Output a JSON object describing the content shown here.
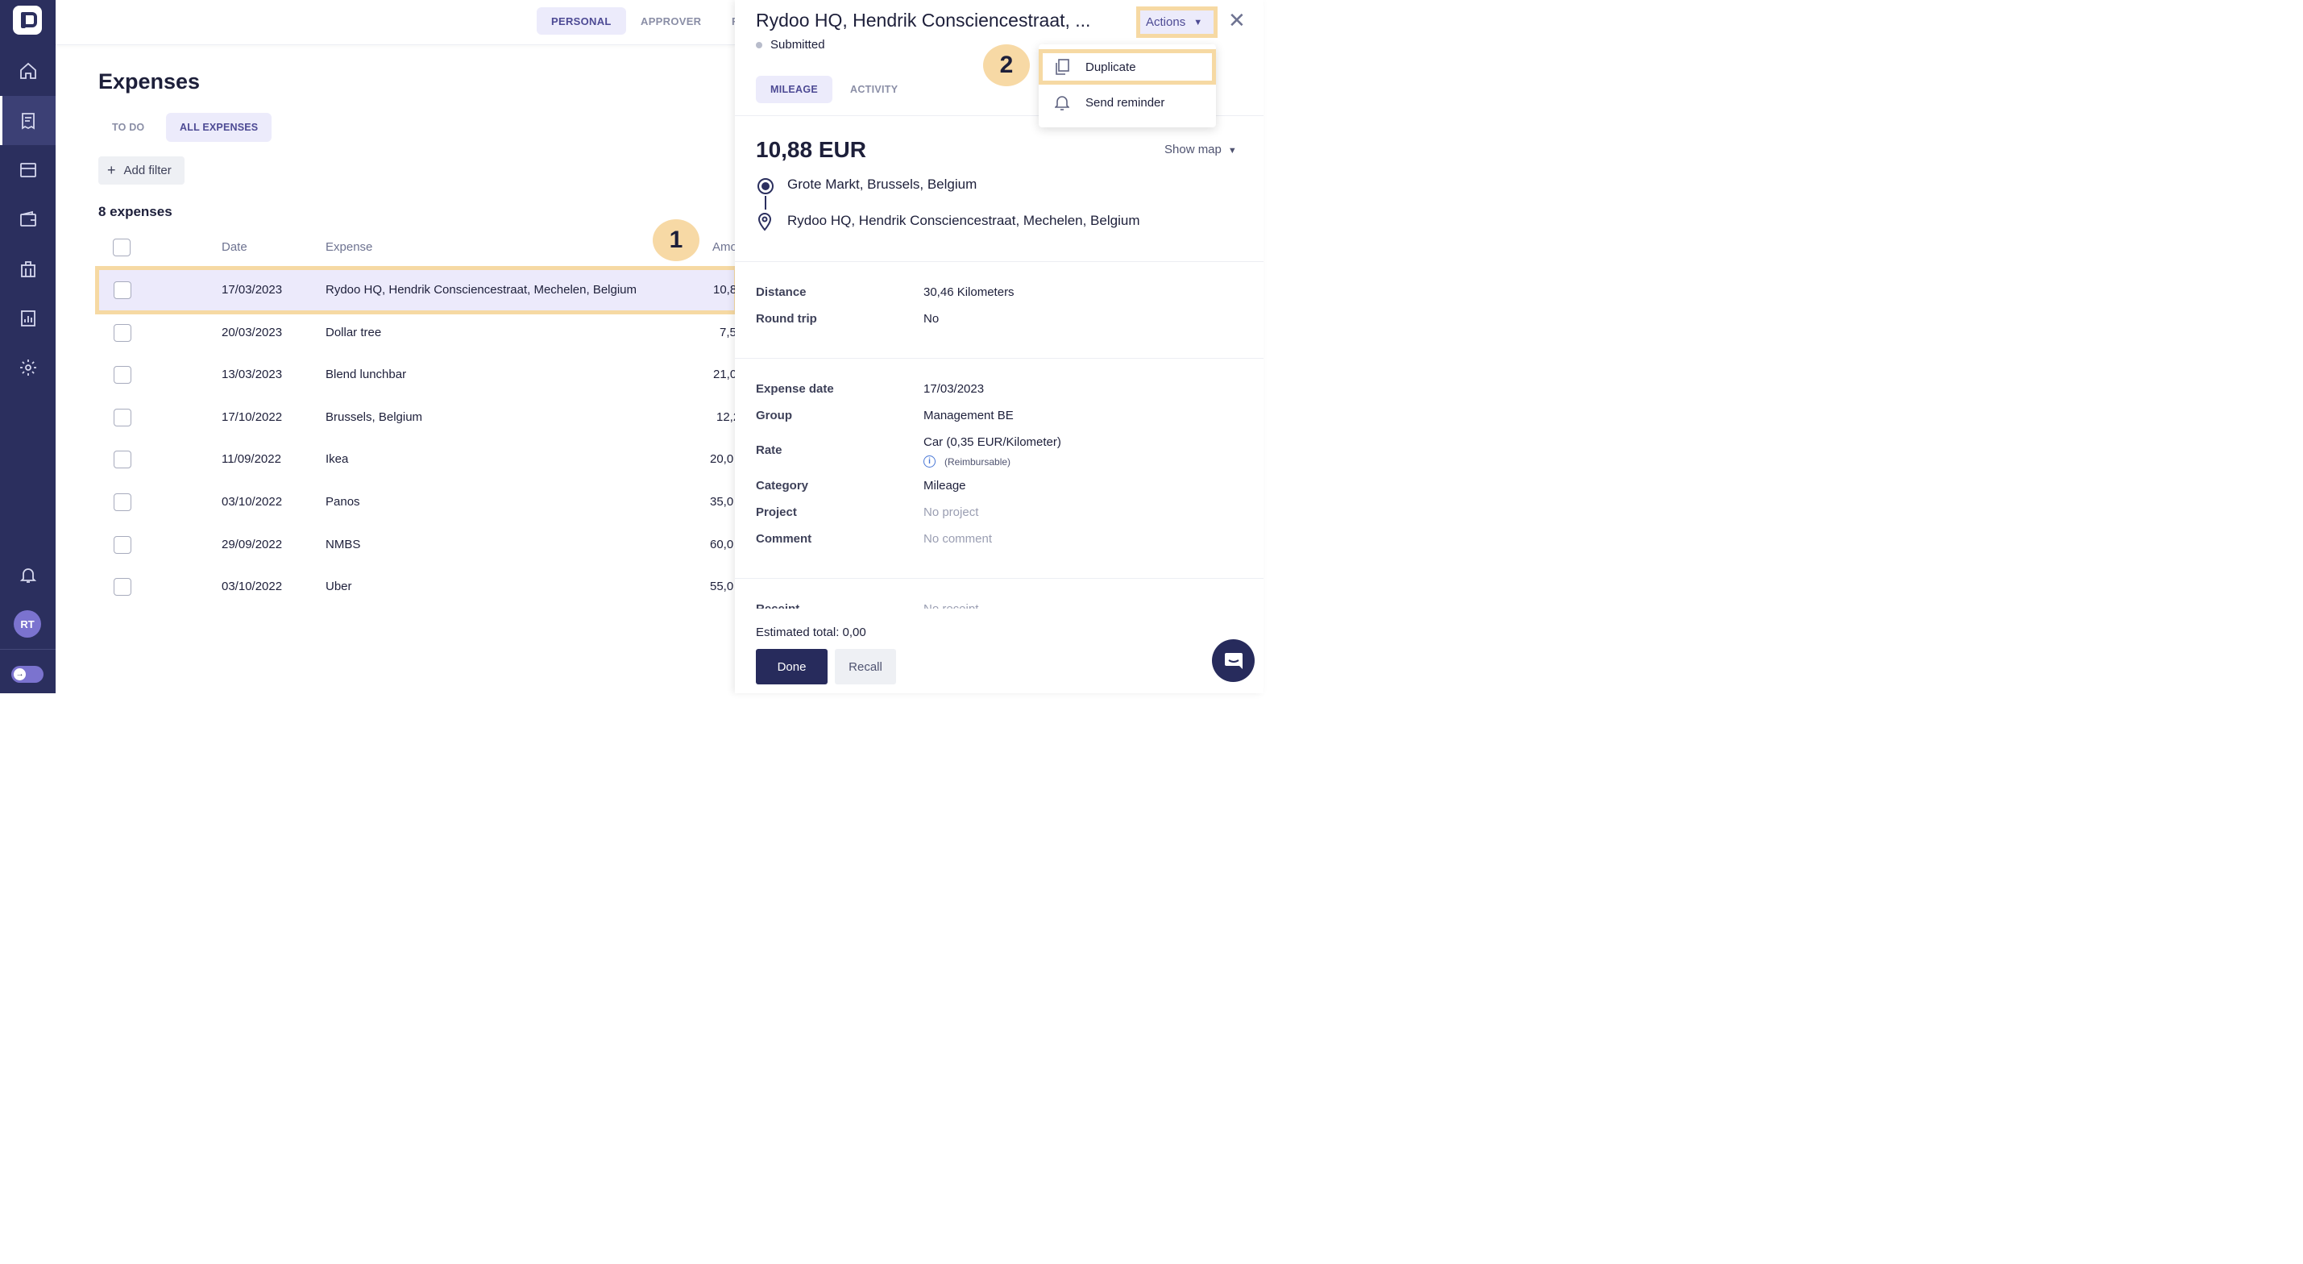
{
  "sidebar": {
    "nav_icons": [
      "home-icon",
      "expenses-icon",
      "cards-icon",
      "wallet-icon",
      "company-icon",
      "reports-icon",
      "settings-icon"
    ],
    "active_item": "expenses-icon",
    "notification_icon": "bell-icon",
    "avatar_initials": "RT",
    "toggle_icon": "arrow-right-icon"
  },
  "topbar": {
    "tabs": [
      {
        "label": "PERSONAL",
        "active": true
      },
      {
        "label": "APPROVER",
        "active": false
      },
      {
        "label": "F",
        "active": false
      }
    ]
  },
  "main": {
    "title": "Expenses",
    "tabs": [
      {
        "label": "TO DO",
        "active": false
      },
      {
        "label": "ALL EXPENSES",
        "active": true
      }
    ],
    "add_filter_label": "Add filter",
    "count_label": "8 expenses",
    "columns": {
      "date": "Date",
      "expense": "Expense",
      "amount": "Amo"
    },
    "rows": [
      {
        "date": "17/03/2023",
        "expense": "Rydoo HQ, Hendrik Consciencestraat, Mechelen, Belgium",
        "amount": "10,8",
        "selected": true
      },
      {
        "date": "20/03/2023",
        "expense": "Dollar tree",
        "amount": "7,5",
        "selected": false
      },
      {
        "date": "13/03/2023",
        "expense": "Blend lunchbar",
        "amount": "21,0",
        "selected": false
      },
      {
        "date": "17/10/2022",
        "expense": "Brussels, Belgium",
        "amount": "12,2",
        "selected": false
      },
      {
        "date": "11/09/2022",
        "expense": "Ikea",
        "amount": "20,0",
        "selected": false
      },
      {
        "date": "03/10/2022",
        "expense": "Panos",
        "amount": "35,0",
        "selected": false
      },
      {
        "date": "29/09/2022",
        "expense": "NMBS",
        "amount": "60,0",
        "selected": false
      },
      {
        "date": "03/10/2022",
        "expense": "Uber",
        "amount": "55,0",
        "selected": false
      }
    ]
  },
  "steps": {
    "one": "1",
    "two": "2"
  },
  "panel": {
    "title": "Rydoo HQ, Hendrik Consciencestraat, ...",
    "status": "Submitted",
    "actions_label": "Actions",
    "tabs": [
      {
        "label": "MILEAGE",
        "active": true
      },
      {
        "label": "ACTIVITY",
        "active": false
      }
    ],
    "amount": "10,88 EUR",
    "show_map_label": "Show map",
    "route": {
      "origin": "Grote Markt, Brussels, Belgium",
      "destination": "Rydoo HQ, Hendrik Consciencestraat, Mechelen, Belgium"
    },
    "trip": [
      {
        "label": "Distance",
        "value": "30,46 Kilometers"
      },
      {
        "label": "Round trip",
        "value": "No"
      }
    ],
    "details": {
      "expense_date": {
        "label": "Expense date",
        "value": "17/03/2023"
      },
      "group": {
        "label": "Group",
        "value": "Management BE"
      },
      "rate": {
        "label": "Rate",
        "value": "Car (0,35 EUR/Kilometer)",
        "note": "(Reimbursable)"
      },
      "category": {
        "label": "Category",
        "value": "Mileage"
      },
      "project": {
        "label": "Project",
        "value": "No project"
      },
      "comment": {
        "label": "Comment",
        "value": "No comment"
      },
      "receipt": {
        "label": "Receipt",
        "value": "No receipt"
      }
    },
    "estimated_total": "Estimated total: 0,00",
    "done_label": "Done",
    "recall_label": "Recall"
  },
  "dropdown": {
    "items": [
      {
        "label": "Duplicate",
        "icon": "duplicate-icon"
      },
      {
        "label": "Send reminder",
        "icon": "bell-icon"
      }
    ]
  },
  "colors": {
    "sidebar": "#2b2f5e",
    "accent": "#4d4a94",
    "highlight": "#f6d9a3",
    "selected_row": "#eceafb"
  }
}
